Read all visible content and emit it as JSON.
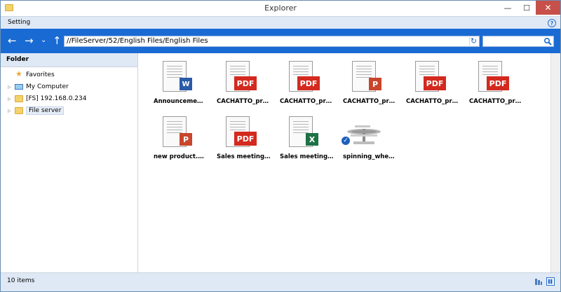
{
  "window": {
    "title": "Explorer",
    "minimize": "—",
    "maximize": "☐",
    "close": "✕"
  },
  "menu": {
    "setting": "Setting",
    "help": "?"
  },
  "nav": {
    "back": "←",
    "forward": "→",
    "dropdown": "⌄",
    "up": "↑",
    "address": "//FileServer/52/English Files/English Files",
    "refresh": "↻",
    "search_placeholder": "",
    "search_icon": "magnifier-icon"
  },
  "sidebar": {
    "header": "Folder",
    "items": [
      {
        "label": "Favorites",
        "icon": "star-icon",
        "expandable": false
      },
      {
        "label": "My Computer",
        "icon": "computer-icon",
        "expandable": true
      },
      {
        "label": "[FS] 192.168.0.234",
        "icon": "folder-icon",
        "expandable": true
      },
      {
        "label": "File server",
        "icon": "folder-icon",
        "expandable": true,
        "selected": true
      }
    ]
  },
  "files": [
    {
      "name": "Announceme…",
      "type": "word",
      "badge": "W"
    },
    {
      "name": "CACHATTO_pr…",
      "type": "pdf",
      "badge": "PDF"
    },
    {
      "name": "CACHATTO_pr…",
      "type": "pdf",
      "badge": "PDF"
    },
    {
      "name": "CACHATTO_pr…",
      "type": "ppt",
      "badge": "P"
    },
    {
      "name": "CACHATTO_pr…",
      "type": "pdf",
      "badge": "PDF"
    },
    {
      "name": "CACHATTO_pr…",
      "type": "pdf",
      "badge": "PDF"
    },
    {
      "name": "new product.…",
      "type": "ppt",
      "badge": "P"
    },
    {
      "name": "Sales meeting…",
      "type": "pdf",
      "badge": "PDF"
    },
    {
      "name": "Sales meeting…",
      "type": "excel",
      "badge": "X"
    },
    {
      "name": "spinning_whe…",
      "type": "image",
      "badge": "✓"
    }
  ],
  "status": {
    "count": "10 items"
  },
  "colors": {
    "accent": "#1a6ad4",
    "pdf": "#d3291e",
    "word": "#2a5aa8",
    "ppt": "#c9452b",
    "excel": "#1e7145"
  }
}
